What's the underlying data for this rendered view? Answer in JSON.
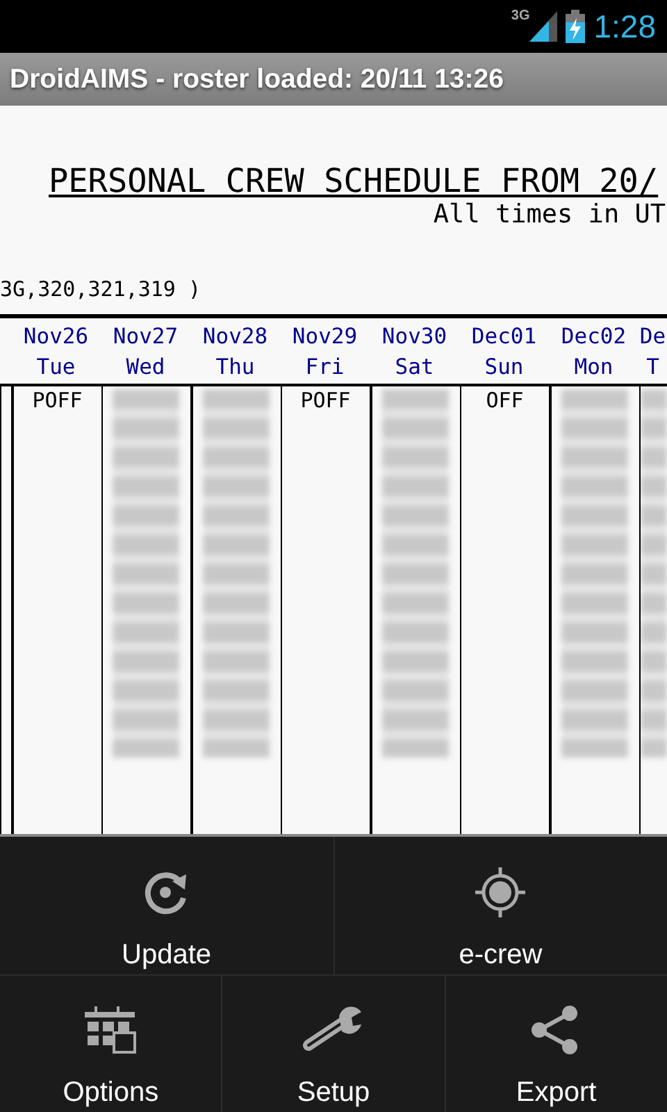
{
  "status_bar": {
    "network": "3G",
    "time": "1:28"
  },
  "window": {
    "title": "DroidAIMS - roster loaded: 20/11 13:26"
  },
  "roster": {
    "heading": "PERSONAL CREW SCHEDULE FROM 20/",
    "subheading": "All times in UT",
    "aircraft_line": "3G,320,321,319 )",
    "columns": [
      {
        "cell": {
          "kind": "empty"
        }
      },
      {
        "date": "Nov26",
        "day": "Tue",
        "cell": {
          "kind": "text",
          "text": "POFF"
        }
      },
      {
        "date": "Nov27",
        "day": "Wed",
        "cell": {
          "kind": "redacted"
        }
      },
      {
        "date": "Nov28",
        "day": "Thu",
        "cell": {
          "kind": "redacted"
        }
      },
      {
        "date": "Nov29",
        "day": "Fri",
        "cell": {
          "kind": "text",
          "text": "POFF"
        }
      },
      {
        "date": "Nov30",
        "day": "Sat",
        "cell": {
          "kind": "redacted"
        }
      },
      {
        "date": "Dec01",
        "day": "Sun",
        "cell": {
          "kind": "text",
          "text": "OFF"
        }
      },
      {
        "date": "Dec02",
        "day": "Mon",
        "cell": {
          "kind": "redacted"
        }
      },
      {
        "date": "De",
        "day": "T",
        "cell": {
          "kind": "redacted"
        }
      }
    ]
  },
  "menu": {
    "rows": [
      [
        {
          "label": "Update"
        },
        {
          "label": "e-crew"
        }
      ],
      [
        {
          "label": "Options"
        },
        {
          "label": "Setup"
        },
        {
          "label": "Export"
        }
      ]
    ]
  }
}
